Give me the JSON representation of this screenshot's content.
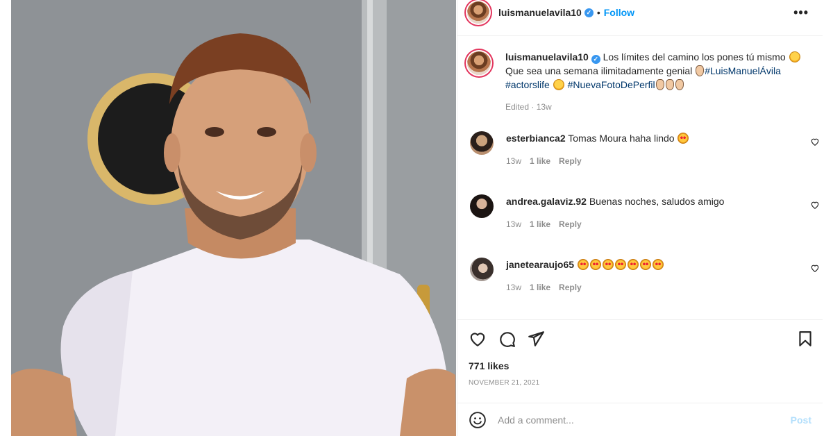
{
  "post": {
    "username": "luismanuelavila10",
    "follow_label": "Follow",
    "dot": "•",
    "more_label": "•••",
    "verified_mark": "✓"
  },
  "caption": {
    "username": "luismanuelavila10",
    "text_1": "Los límites del camino los pones tú mismo",
    "text_2": "Que sea una semana ilimitadamente genial",
    "hashtag_1": "#LuisManuelÁvila",
    "hashtag_2": "#actorslife",
    "hashtag_3": "#NuevaFotoDePerfil",
    "edited": "Edited · 13w"
  },
  "comments": [
    {
      "username": "esterbianca2",
      "text": "Tomas Moura haha lindo",
      "time": "13w",
      "likes": "1 like",
      "reply": "Reply"
    },
    {
      "username": "andrea.galaviz.92",
      "text": "Buenas noches, saludos amigo",
      "time": "13w",
      "likes": "1 like",
      "reply": "Reply"
    },
    {
      "username": "janetearaujo65",
      "text": "",
      "time": "13w",
      "likes": "1 like",
      "reply": "Reply"
    }
  ],
  "likes_label": "771 likes",
  "date_label": "NOVEMBER 21, 2021",
  "add_comment": {
    "placeholder": "Add a comment...",
    "post_label": "Post"
  },
  "icons": [
    "heart-icon",
    "comment-icon",
    "share-icon",
    "bookmark-icon",
    "emoji-icon",
    "more-options-icon",
    "verified-badge-icon"
  ],
  "colors": {
    "link": "#0095f6",
    "hashtag": "#00376b",
    "muted": "#8e8e8e",
    "verified": "#3897f0",
    "post_disabled": "#b2dffc"
  }
}
